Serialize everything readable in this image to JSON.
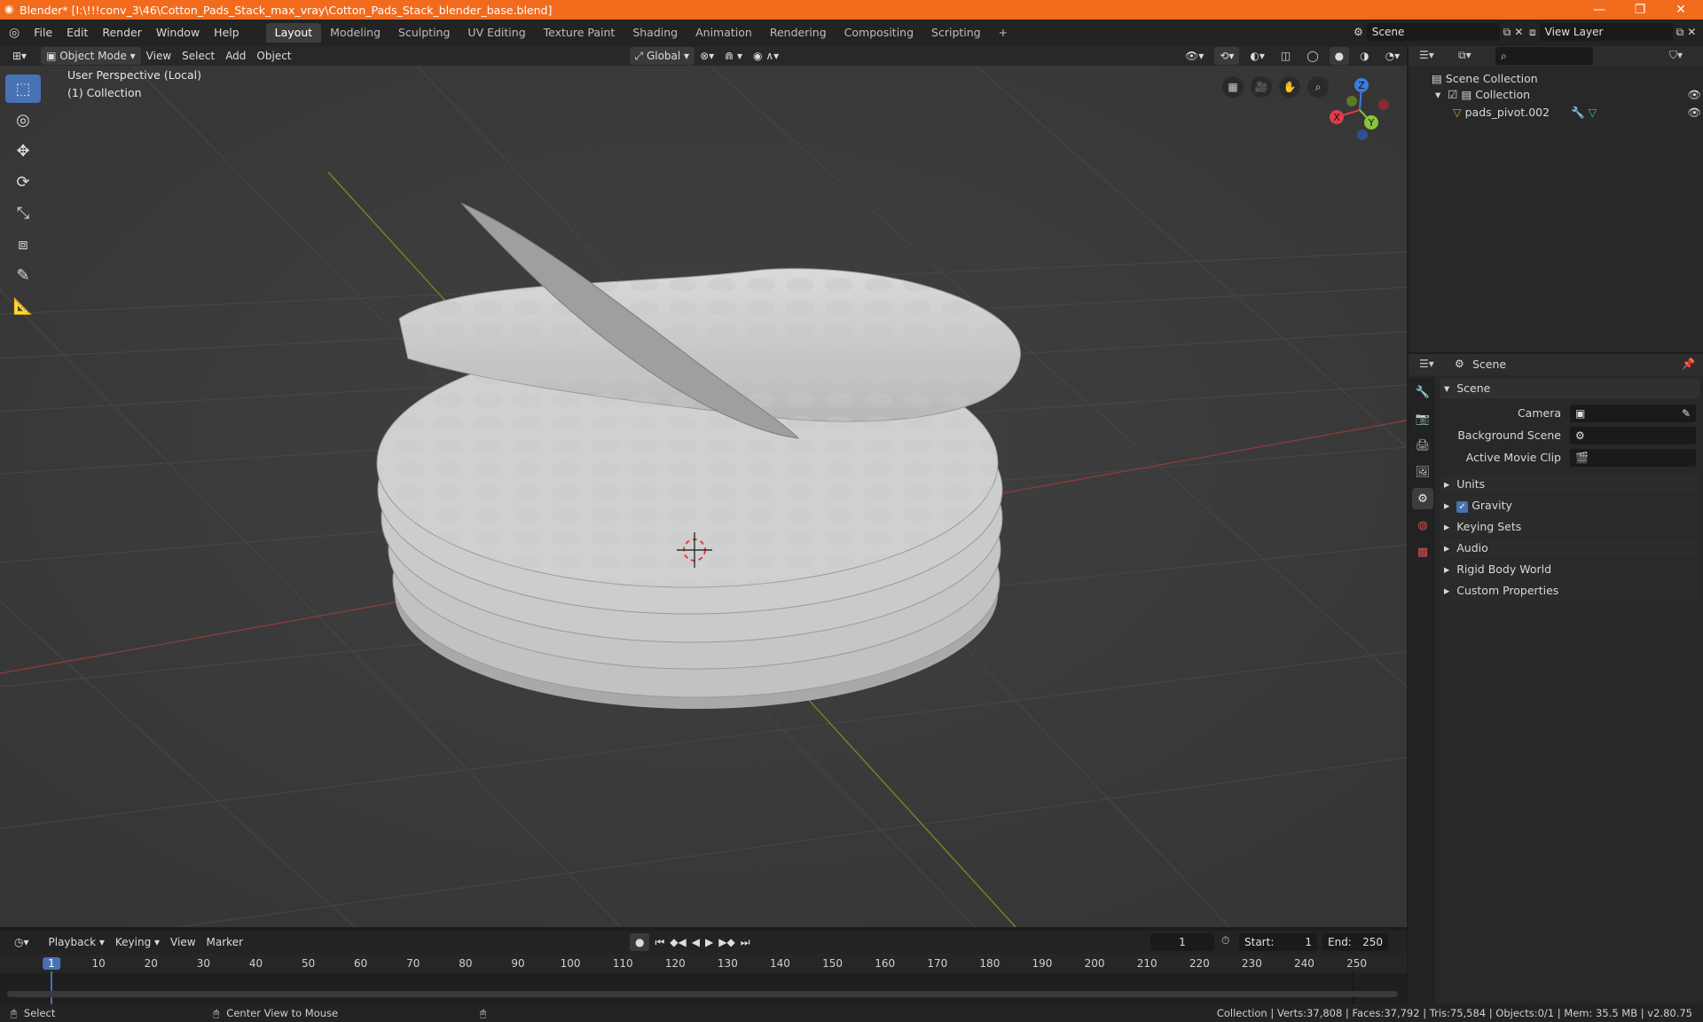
{
  "titlebar": {
    "title": "Blender* [I:\\!!!conv_3\\46\\Cotton_Pads_Stack_max_vray\\Cotton_Pads_Stack_blender_base.blend]"
  },
  "menus": [
    "File",
    "Edit",
    "Render",
    "Window",
    "Help"
  ],
  "workspaces": [
    "Layout",
    "Modeling",
    "Sculpting",
    "UV Editing",
    "Texture Paint",
    "Shading",
    "Animation",
    "Rendering",
    "Compositing",
    "Scripting"
  ],
  "active_workspace": "Layout",
  "scene_field": "Scene",
  "viewlayer_field": "View Layer",
  "viewport_header": {
    "mode": "Object Mode",
    "view": "View",
    "select": "Select",
    "add": "Add",
    "object": "Object",
    "orientation": "Global"
  },
  "viewport": {
    "perspective": "User Perspective (Local)",
    "collection": "(1) Collection"
  },
  "gizmo": {
    "x": "X",
    "y": "Y",
    "z": "Z"
  },
  "outliner": {
    "scene_collection": "Scene Collection",
    "collection": "Collection",
    "object": "pads_pivot.002"
  },
  "properties": {
    "header": "Scene",
    "panel": "Scene",
    "camera_label": "Camera",
    "background_label": "Background Scene",
    "movieclip_label": "Active Movie Clip",
    "sections": [
      "Units",
      "Gravity",
      "Keying Sets",
      "Audio",
      "Rigid Body World",
      "Custom Properties"
    ]
  },
  "timeline": {
    "playback": "Playback",
    "keying": "Keying",
    "view": "View",
    "marker": "Marker",
    "current_frame": "1",
    "start_label": "Start:",
    "start": "1",
    "end_label": "End:",
    "end": "250",
    "ticks": [
      "1",
      "10",
      "20",
      "30",
      "40",
      "50",
      "60",
      "70",
      "80",
      "90",
      "100",
      "110",
      "120",
      "130",
      "140",
      "150",
      "160",
      "170",
      "180",
      "190",
      "200",
      "210",
      "220",
      "230",
      "240",
      "250"
    ]
  },
  "status": {
    "select": "Select",
    "center": "Center View to Mouse",
    "stats": "Collection | Verts:37,808 | Faces:37,792 | Tris:75,584 | Objects:0/1 | Mem: 35.5 MB | v2.80.75"
  },
  "colors": {
    "title_bg": "#f26b1d",
    "accent": "#4772b3",
    "x_axis": "#e23a48",
    "y_axis": "#8ac43a",
    "z_axis": "#3c7de0"
  }
}
